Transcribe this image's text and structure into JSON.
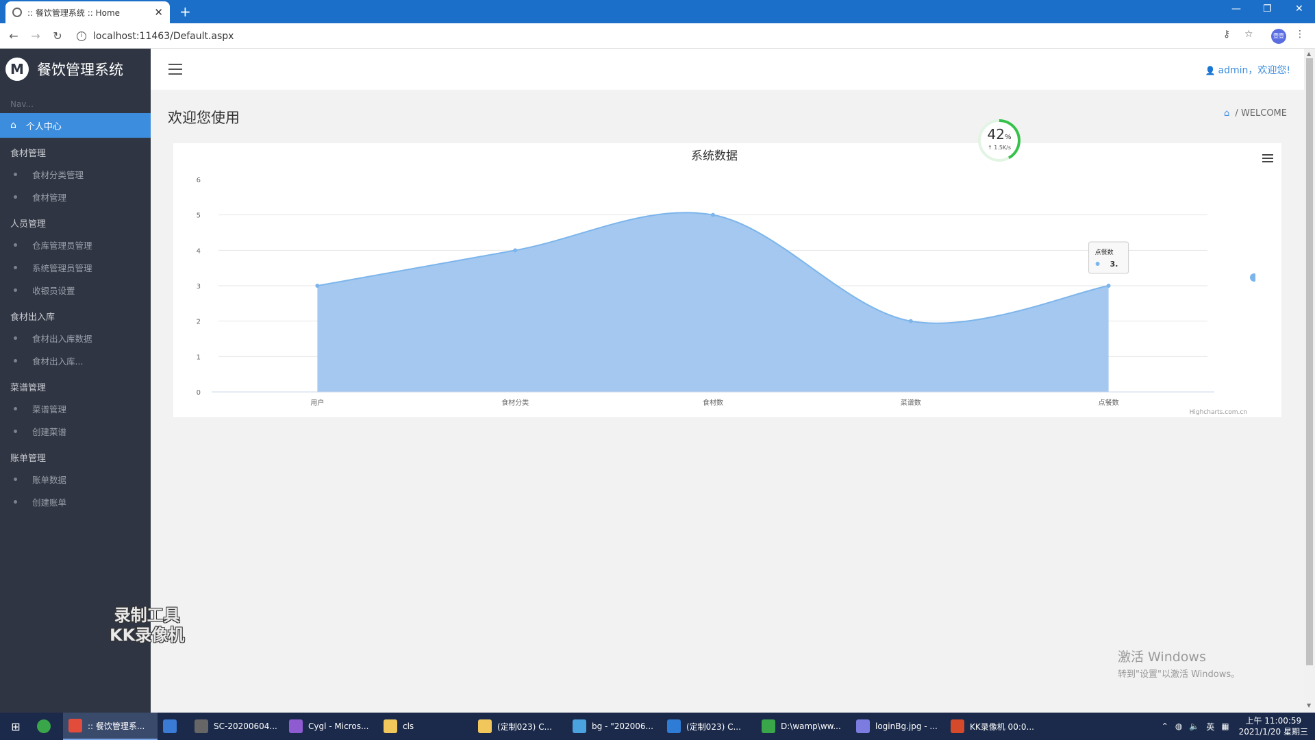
{
  "browser": {
    "tab_title": ":: 餐饮管理系统 :: Home",
    "new_tab": "+",
    "url": "localhost:11463/Default.aspx",
    "profile_label": "壹壹"
  },
  "sidebar": {
    "brand": "餐饮管理系统",
    "logo_letter": "M",
    "nav_heading": "Nav...",
    "active_item": "个人中心",
    "groups": [
      {
        "label": "食材管理",
        "items": [
          "食材分类管理",
          "食材管理"
        ]
      },
      {
        "label": "人员管理",
        "items": [
          "仓库管理员管理",
          "系统管理员管理",
          "收银员设置"
        ]
      },
      {
        "label": "食材出入库",
        "items": [
          "食材出入库数据",
          "食材出入库..."
        ]
      },
      {
        "label": "菜谱管理",
        "items": [
          "菜谱管理",
          "创建菜谱"
        ]
      },
      {
        "label": "账单管理",
        "items": [
          "账单数据",
          "创建账单"
        ]
      }
    ]
  },
  "header": {
    "user_text": "admin，欢迎您!"
  },
  "content": {
    "page_title": "欢迎您使用",
    "breadcrumb": "WELCOME",
    "gauge_value": 42,
    "gauge_unit": "%",
    "gauge_speed": "↑ 1.5K/s"
  },
  "chart_data": {
    "type": "area",
    "title": "系统数据",
    "categories": [
      "用户",
      "食材分类",
      "食材数",
      "菜谱数",
      "点餐数"
    ],
    "series": [
      {
        "values": [
          3,
          4,
          5,
          2,
          3
        ]
      }
    ],
    "yticks": [
      0,
      1,
      2,
      3,
      4,
      5,
      6
    ],
    "ylim": [
      0,
      6
    ],
    "ylabel": "",
    "xlabel": "",
    "smooth": true,
    "fill_color": "#9fc5ee",
    "line_color": "#7cb5ec",
    "credits": "Highcharts.com.cn",
    "tooltip": {
      "category": "点餐数",
      "value": "3."
    },
    "legend_position": "right"
  },
  "overlays": {
    "watermark_line1": "录制工具",
    "watermark_line2": "KK录像机",
    "activate_line1": "激活 Windows",
    "activate_line2": "转到\"设置\"以激活 Windows。"
  },
  "taskbar": {
    "tasks": [
      {
        "label": ":: 餐饮管理系...",
        "color": "#e24c3b"
      },
      {
        "label": "",
        "color": "#3a7bd5"
      },
      {
        "label": "SC-20200604...",
        "color": "#666666"
      },
      {
        "label": "Cygl - Micros...",
        "color": "#8e5bd1"
      },
      {
        "label": "cls",
        "color": "#f1c75b"
      },
      {
        "label": "(定制023) C...",
        "color": "#f1c75b"
      },
      {
        "label": "bg - \"202006...",
        "color": "#4aa3df"
      },
      {
        "label": "(定制023) C...",
        "color": "#2f7cd6"
      },
      {
        "label": "D:\\wamp\\ww...",
        "color": "#3aa64a"
      },
      {
        "label": "loginBg.jpg - ...",
        "color": "#7b7be0"
      },
      {
        "label": "KK录像机 00:0...",
        "color": "#d44a2a"
      }
    ],
    "ime": "英",
    "time": "上午 11:00:59",
    "date": "2021/1/20 星期三"
  }
}
